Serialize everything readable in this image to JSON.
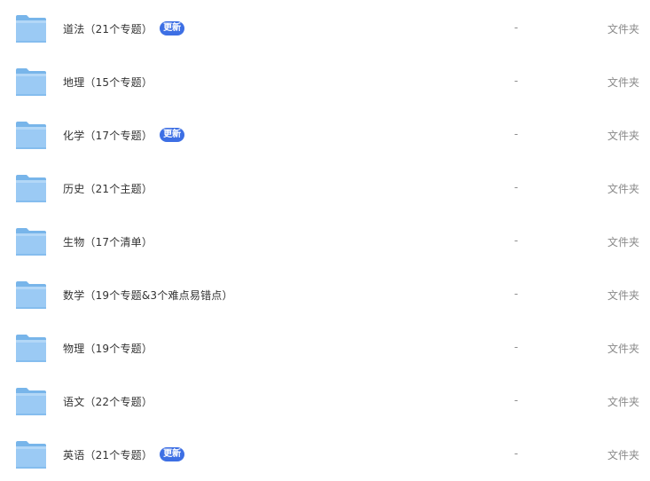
{
  "theme": {
    "badge_color": "#3d6fe4",
    "folder_color": "#8fc3f2"
  },
  "files": [
    {
      "name": "道法（21个专题）",
      "badge": "更新",
      "size": "-",
      "type": "文件夹",
      "icon": "folder-icon"
    },
    {
      "name": "地理（15个专题）",
      "badge": "",
      "size": "-",
      "type": "文件夹",
      "icon": "folder-icon"
    },
    {
      "name": "化学（17个专题）",
      "badge": "更新",
      "size": "-",
      "type": "文件夹",
      "icon": "folder-icon"
    },
    {
      "name": "历史（21个主题）",
      "badge": "",
      "size": "-",
      "type": "文件夹",
      "icon": "folder-icon"
    },
    {
      "name": "生物（17个清单）",
      "badge": "",
      "size": "-",
      "type": "文件夹",
      "icon": "folder-icon"
    },
    {
      "name": "数学（19个专题&3个难点易错点）",
      "badge": "",
      "size": "-",
      "type": "文件夹",
      "icon": "folder-icon"
    },
    {
      "name": "物理（19个专题）",
      "badge": "",
      "size": "-",
      "type": "文件夹",
      "icon": "folder-icon"
    },
    {
      "name": "语文（22个专题）",
      "badge": "",
      "size": "-",
      "type": "文件夹",
      "icon": "folder-icon"
    },
    {
      "name": "英语（21个专题）",
      "badge": "更新",
      "size": "-",
      "type": "文件夹",
      "icon": "folder-icon"
    }
  ]
}
